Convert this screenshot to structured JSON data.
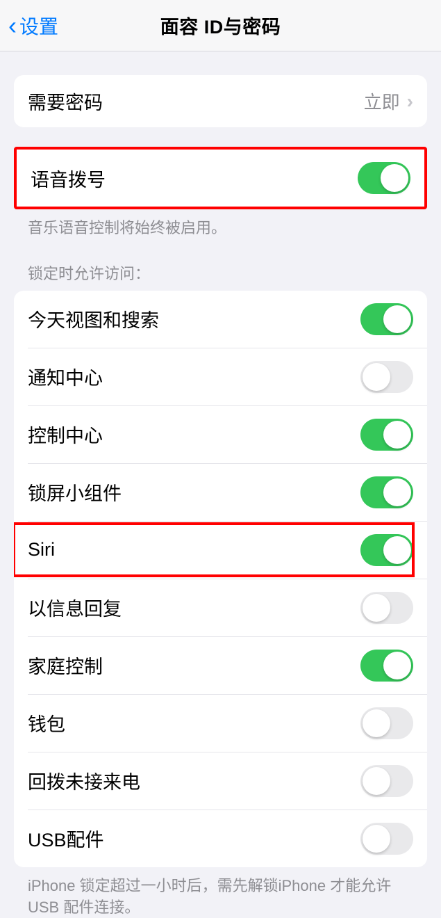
{
  "header": {
    "back_label": "设置",
    "title": "面容 ID与密码"
  },
  "passcode_group": {
    "require_passcode": {
      "label": "需要密码",
      "value": "立即"
    }
  },
  "voice_dial_group": {
    "voice_dial": {
      "label": "语音拨号",
      "on": true
    },
    "footer": "音乐语音控制将始终被启用。"
  },
  "locked_access": {
    "header": "锁定时允许访问：",
    "items": [
      {
        "label": "今天视图和搜索",
        "on": true,
        "highlight": false
      },
      {
        "label": "通知中心",
        "on": false,
        "highlight": false
      },
      {
        "label": "控制中心",
        "on": true,
        "highlight": false
      },
      {
        "label": "锁屏小组件",
        "on": true,
        "highlight": false
      },
      {
        "label": "Siri",
        "on": true,
        "highlight": true
      },
      {
        "label": "以信息回复",
        "on": false,
        "highlight": false
      },
      {
        "label": "家庭控制",
        "on": true,
        "highlight": false
      },
      {
        "label": "钱包",
        "on": false,
        "highlight": false
      },
      {
        "label": "回拨未接来电",
        "on": false,
        "highlight": false
      },
      {
        "label": "USB配件",
        "on": false,
        "highlight": false
      }
    ],
    "footer": "iPhone 锁定超过一小时后，需先解锁iPhone 才能允许USB 配件连接。"
  }
}
